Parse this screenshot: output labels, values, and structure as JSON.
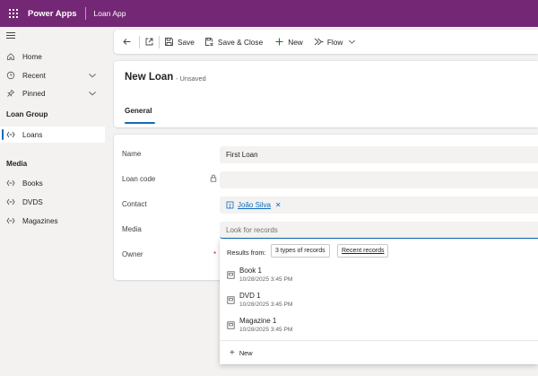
{
  "topbar": {
    "app_name": "Power Apps",
    "app_sub": "Loan App",
    "bg_color": "#742774",
    "waffle_icon": "waffle-grid-icon"
  },
  "sidebar": {
    "items": [
      {
        "label": "Home",
        "icon": "home-icon"
      },
      {
        "label": "Recent",
        "icon": "clock-icon",
        "expandable": true
      },
      {
        "label": "Pinned",
        "icon": "pin-icon",
        "expandable": true
      }
    ],
    "groups": [
      {
        "title": "Loan Group",
        "items": [
          {
            "label": "Loans",
            "icon": "entity-icon",
            "active": true
          }
        ]
      },
      {
        "title": "Media",
        "items": [
          {
            "label": "Books",
            "icon": "entity-icon"
          },
          {
            "label": "DVDS",
            "icon": "entity-icon"
          },
          {
            "label": "Magazines",
            "icon": "entity-icon"
          }
        ]
      }
    ]
  },
  "toolbar": {
    "save_label": "Save",
    "save_close_label": "Save & Close",
    "new_label": "New",
    "flow_label": "Flow"
  },
  "record": {
    "title": "New Loan",
    "status": "- Unsaved",
    "tab": "General"
  },
  "form": {
    "fields": [
      {
        "label": "Name",
        "value": "First Loan"
      },
      {
        "label": "Loan code",
        "value": "",
        "locked": true
      },
      {
        "label": "Contact",
        "value": "João Silva"
      },
      {
        "label": "Media",
        "placeholder": "Look for records"
      },
      {
        "label": "Owner",
        "value": "",
        "required": "*"
      }
    ]
  },
  "lookup": {
    "results_from": "Results from:",
    "filter_chip": "3 types of records",
    "recent_chip": "Recent records",
    "results": [
      {
        "name": "Book 1",
        "date": "10/28/2025 3:45 PM"
      },
      {
        "name": "DVD 1",
        "date": "10/28/2025 3:45 PM"
      },
      {
        "name": "Magazine 1",
        "date": "10/28/2025 3:45 PM"
      }
    ],
    "new_label": "New"
  },
  "colors": {
    "accent": "#0f6cbd",
    "brand": "#742774"
  }
}
